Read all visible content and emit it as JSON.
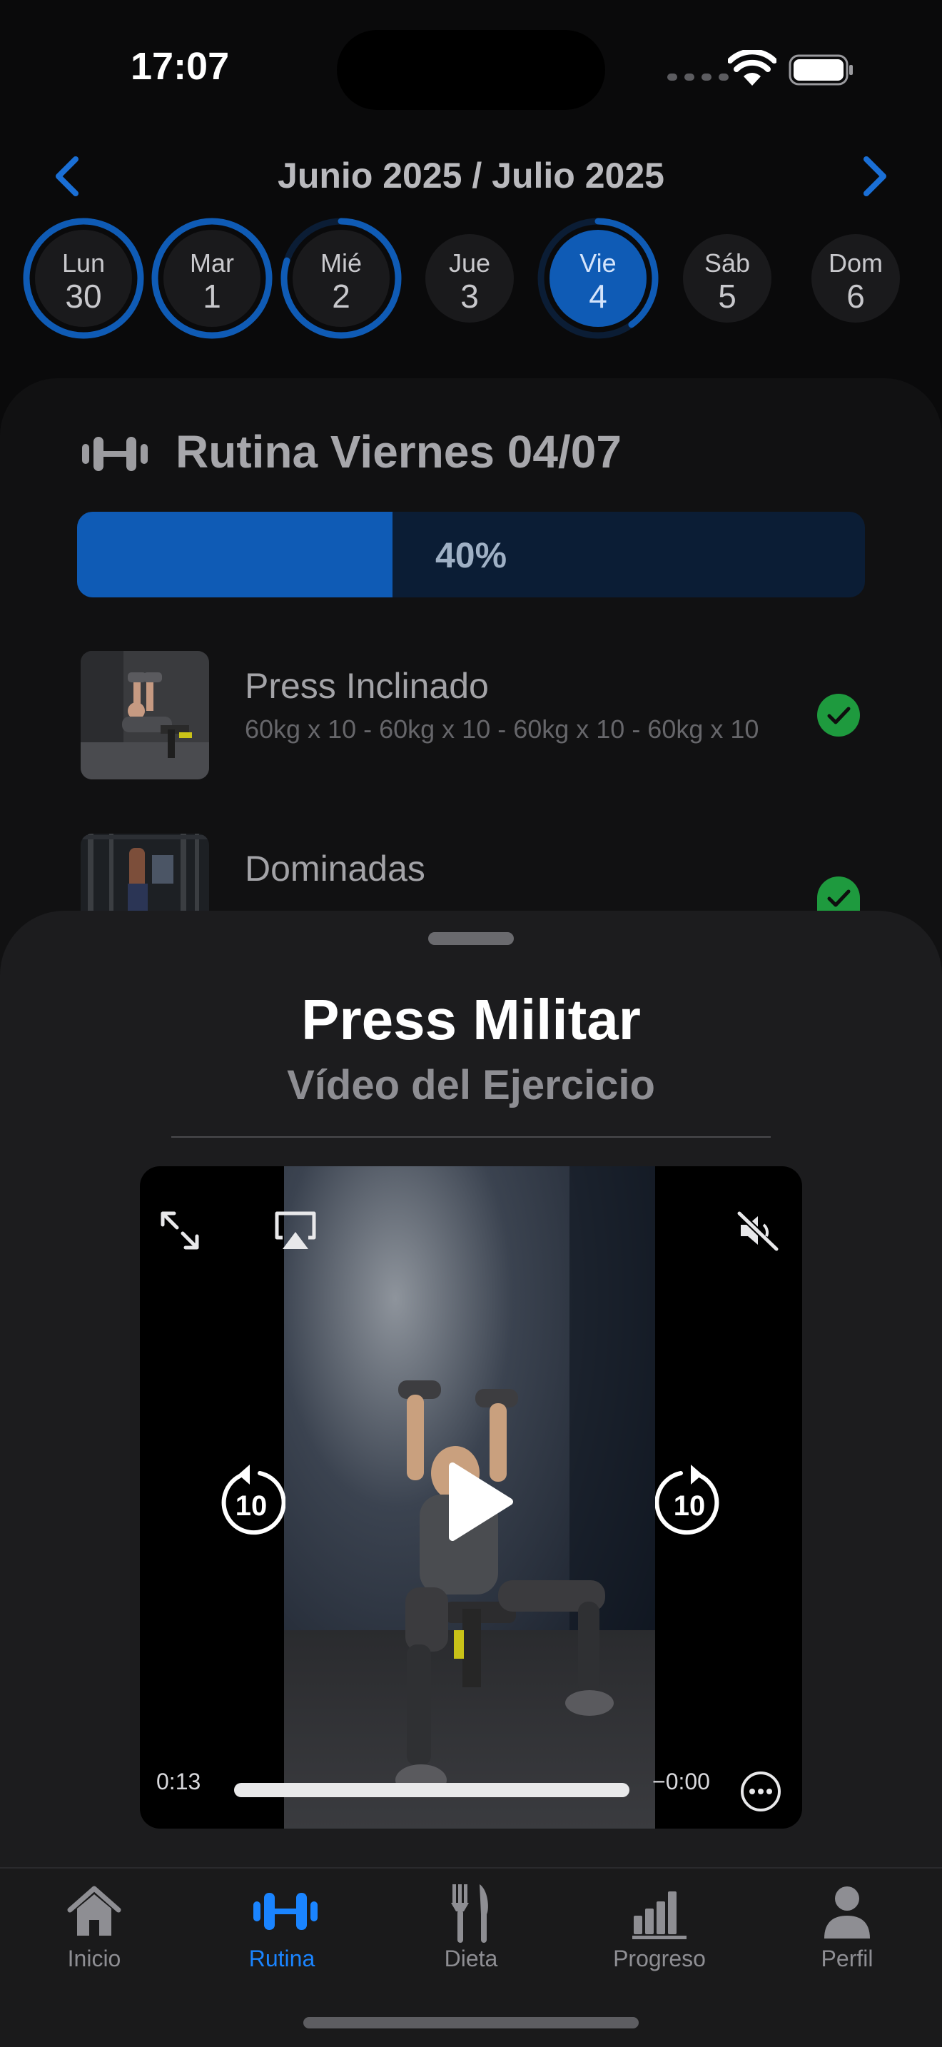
{
  "status_bar": {
    "time": "17:07"
  },
  "calendar": {
    "title": "Junio 2025 / Julio 2025",
    "accent_color": "#0f5bb5",
    "days": [
      {
        "label": "Lun",
        "number": "30",
        "progress": 1.0,
        "selected": false
      },
      {
        "label": "Mar",
        "number": "1",
        "progress": 1.0,
        "selected": false
      },
      {
        "label": "Mié",
        "number": "2",
        "progress": 0.8,
        "selected": false
      },
      {
        "label": "Jue",
        "number": "3",
        "progress": 0.0,
        "selected": false
      },
      {
        "label": "Vie",
        "number": "4",
        "progress": 0.4,
        "selected": true
      },
      {
        "label": "Sáb",
        "number": "5",
        "progress": 0.0,
        "selected": false
      },
      {
        "label": "Dom",
        "number": "6",
        "progress": 0.0,
        "selected": false
      }
    ]
  },
  "routine": {
    "icon": "dumbbell-icon",
    "title": "Rutina Viernes 04/07",
    "progress": 0.4,
    "progress_label": "40%",
    "exercises": [
      {
        "name": "Press Inclinado",
        "sets": "60kg x 10 - 60kg x 10 - 60kg x 10 - 60kg x 10",
        "completed": true
      },
      {
        "name": "Dominadas",
        "sets": "",
        "completed": true
      }
    ]
  },
  "sheet": {
    "title": "Press Militar",
    "subtitle": "Vídeo del Ejercicio"
  },
  "player": {
    "elapsed": "0:13",
    "remaining": "−0:00",
    "skip_seconds": "10",
    "progress": 1.0
  },
  "tabs": [
    {
      "label": "Inicio",
      "icon": "home-icon",
      "active": false
    },
    {
      "label": "Rutina",
      "icon": "dumbbell-icon",
      "active": true
    },
    {
      "label": "Dieta",
      "icon": "fork-knife-icon",
      "active": false
    },
    {
      "label": "Progreso",
      "icon": "bar-chart-icon",
      "active": false
    },
    {
      "label": "Perfil",
      "icon": "person-icon",
      "active": false
    }
  ]
}
